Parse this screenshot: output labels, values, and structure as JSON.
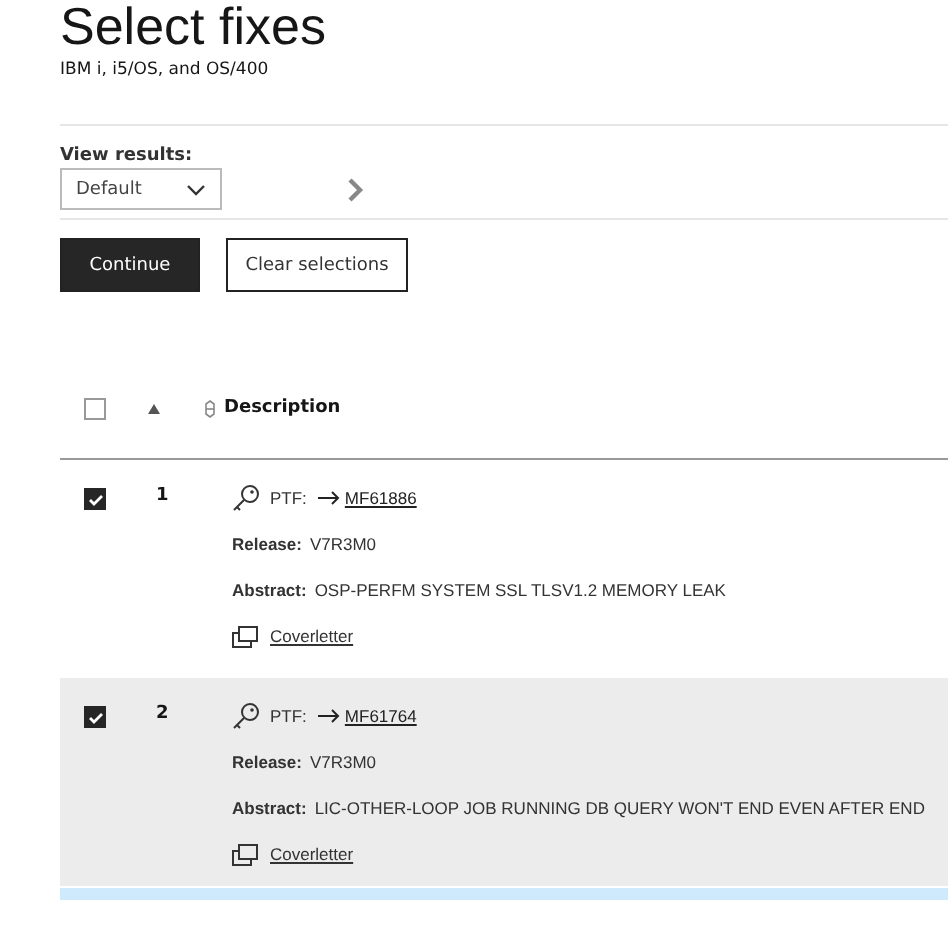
{
  "page": {
    "title": "Select fixes",
    "subtitle": "IBM i, i5/OS, and OS/400"
  },
  "view_results": {
    "label": "View results:",
    "value": "Default"
  },
  "buttons": [
    {
      "kind": "primary",
      "label": "Continue"
    },
    {
      "kind": "secondary",
      "label": "Clear selections"
    }
  ],
  "table": {
    "header": {
      "checked": false,
      "column": "Description"
    },
    "rows": [
      {
        "checked": true,
        "highlighted": false,
        "number": "1",
        "ptf_label": "PTF:",
        "ptf": "MF61886",
        "release_label": "Release:",
        "release": "V7R3M0",
        "abstract_label": "Abstract:",
        "abstract": "OSP-PERFM SYSTEM SSL TLSV1.2 MEMORY LEAK",
        "link": "Coverletter"
      },
      {
        "checked": true,
        "highlighted": true,
        "number": "2",
        "ptf_label": "PTF:",
        "ptf": "MF61764",
        "release_label": "Release:",
        "release": "V7R3M0",
        "abstract_label": "Abstract:",
        "abstract": "LIC-OTHER-LOOP JOB RUNNING DB QUERY WON'T END EVEN AFTER END",
        "link": "Coverletter"
      }
    ]
  }
}
